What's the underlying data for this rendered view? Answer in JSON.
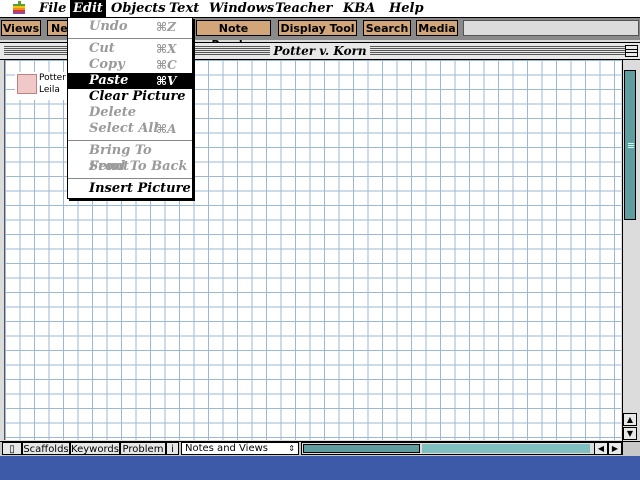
{
  "menubar": {
    "apple": "apple-icon",
    "items": [
      "File",
      "Edit",
      "Objects",
      "Text",
      "Windows",
      "Teacher",
      "KBA",
      "Help"
    ]
  },
  "toolbar": {
    "buttons": [
      "Views",
      "Ne",
      "Note Reader",
      "Display Tool",
      "Search",
      "Media"
    ]
  },
  "window": {
    "title": "Potter v. Korn"
  },
  "canvas": {
    "object_line1": "Potter",
    "object_line2": "Leila"
  },
  "edit_menu": {
    "undo": {
      "label": "Undo",
      "shortcut": "⌘Z"
    },
    "cut": {
      "label": "Cut",
      "shortcut": "⌘X"
    },
    "copy": {
      "label": "Copy",
      "shortcut": "⌘C"
    },
    "paste": {
      "label": "Paste",
      "shortcut": "⌘V"
    },
    "clear_picture": {
      "label": "Clear Picture"
    },
    "delete": {
      "label": "Delete"
    },
    "select_all": {
      "label": "Select All",
      "shortcut": "⌘A"
    },
    "bring_to_front": {
      "label": "Bring To Front"
    },
    "send_to_back": {
      "label": "Send To Back"
    },
    "insert_picture": {
      "label": "Insert Picture"
    }
  },
  "statusbar": {
    "tabs": [
      "Scaffolds",
      "Keywords",
      "Problem",
      "i"
    ],
    "notes_select": "Notes and Views"
  },
  "colors": {
    "toolbar_button": "#d2a679",
    "scroll_thumb": "#5f9ea0",
    "grid_line": "#9db8d6",
    "desktop": "#3d5aa8"
  }
}
